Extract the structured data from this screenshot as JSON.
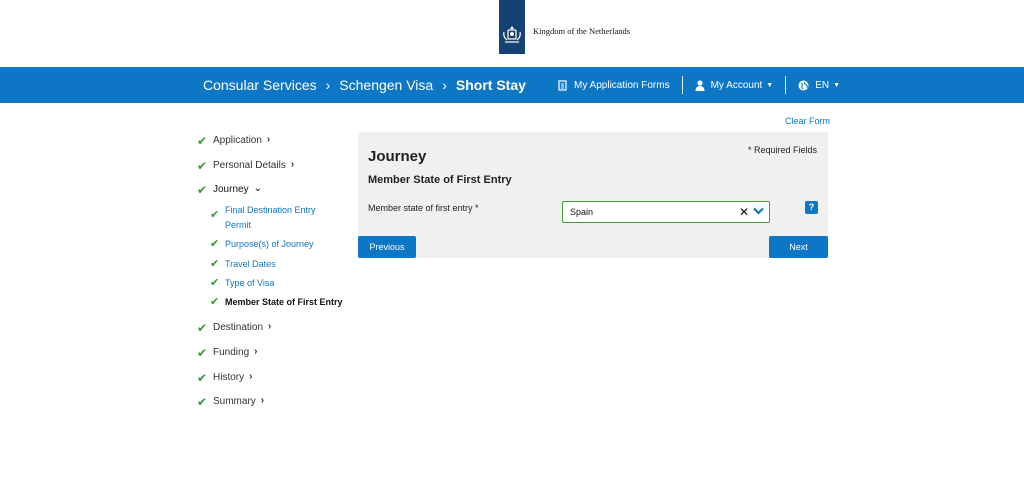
{
  "header": {
    "logo_text": "Kingdom of the Netherlands"
  },
  "nav": {
    "breadcrumbs": [
      "Consular Services",
      "Schengen Visa",
      "Short Stay"
    ],
    "separator": "›",
    "my_forms": "My Application Forms",
    "my_account": "My Account",
    "language": "EN",
    "colors": {
      "bar": "#0d76c5"
    }
  },
  "clear_form": "Clear Form",
  "sidebar": {
    "steps": [
      {
        "label": "Application",
        "chevron": "›"
      },
      {
        "label": "Personal Details",
        "chevron": "›"
      },
      {
        "label": "Journey",
        "chevron": "⌄"
      },
      {
        "label": "Destination",
        "chevron": "›"
      },
      {
        "label": "Funding",
        "chevron": "›"
      },
      {
        "label": "History",
        "chevron": "›"
      },
      {
        "label": "Summary",
        "chevron": "›"
      }
    ],
    "substeps": [
      {
        "line1": "Final Destination Entry",
        "line2": "Permit"
      },
      {
        "label": "Purpose(s) of Journey"
      },
      {
        "label": "Travel Dates"
      },
      {
        "label": "Type of Visa"
      },
      {
        "label": "Member State of First Entry"
      }
    ],
    "check_glyph": "✔"
  },
  "form": {
    "title": "Journey",
    "required_note": "* Required Fields",
    "subtitle": "Member State of First Entry",
    "field_label": "Member state of first entry *",
    "selected_value": "Spain",
    "clear_glyph": "✕",
    "help_glyph": "?",
    "previous": "Previous",
    "next": "Next"
  }
}
